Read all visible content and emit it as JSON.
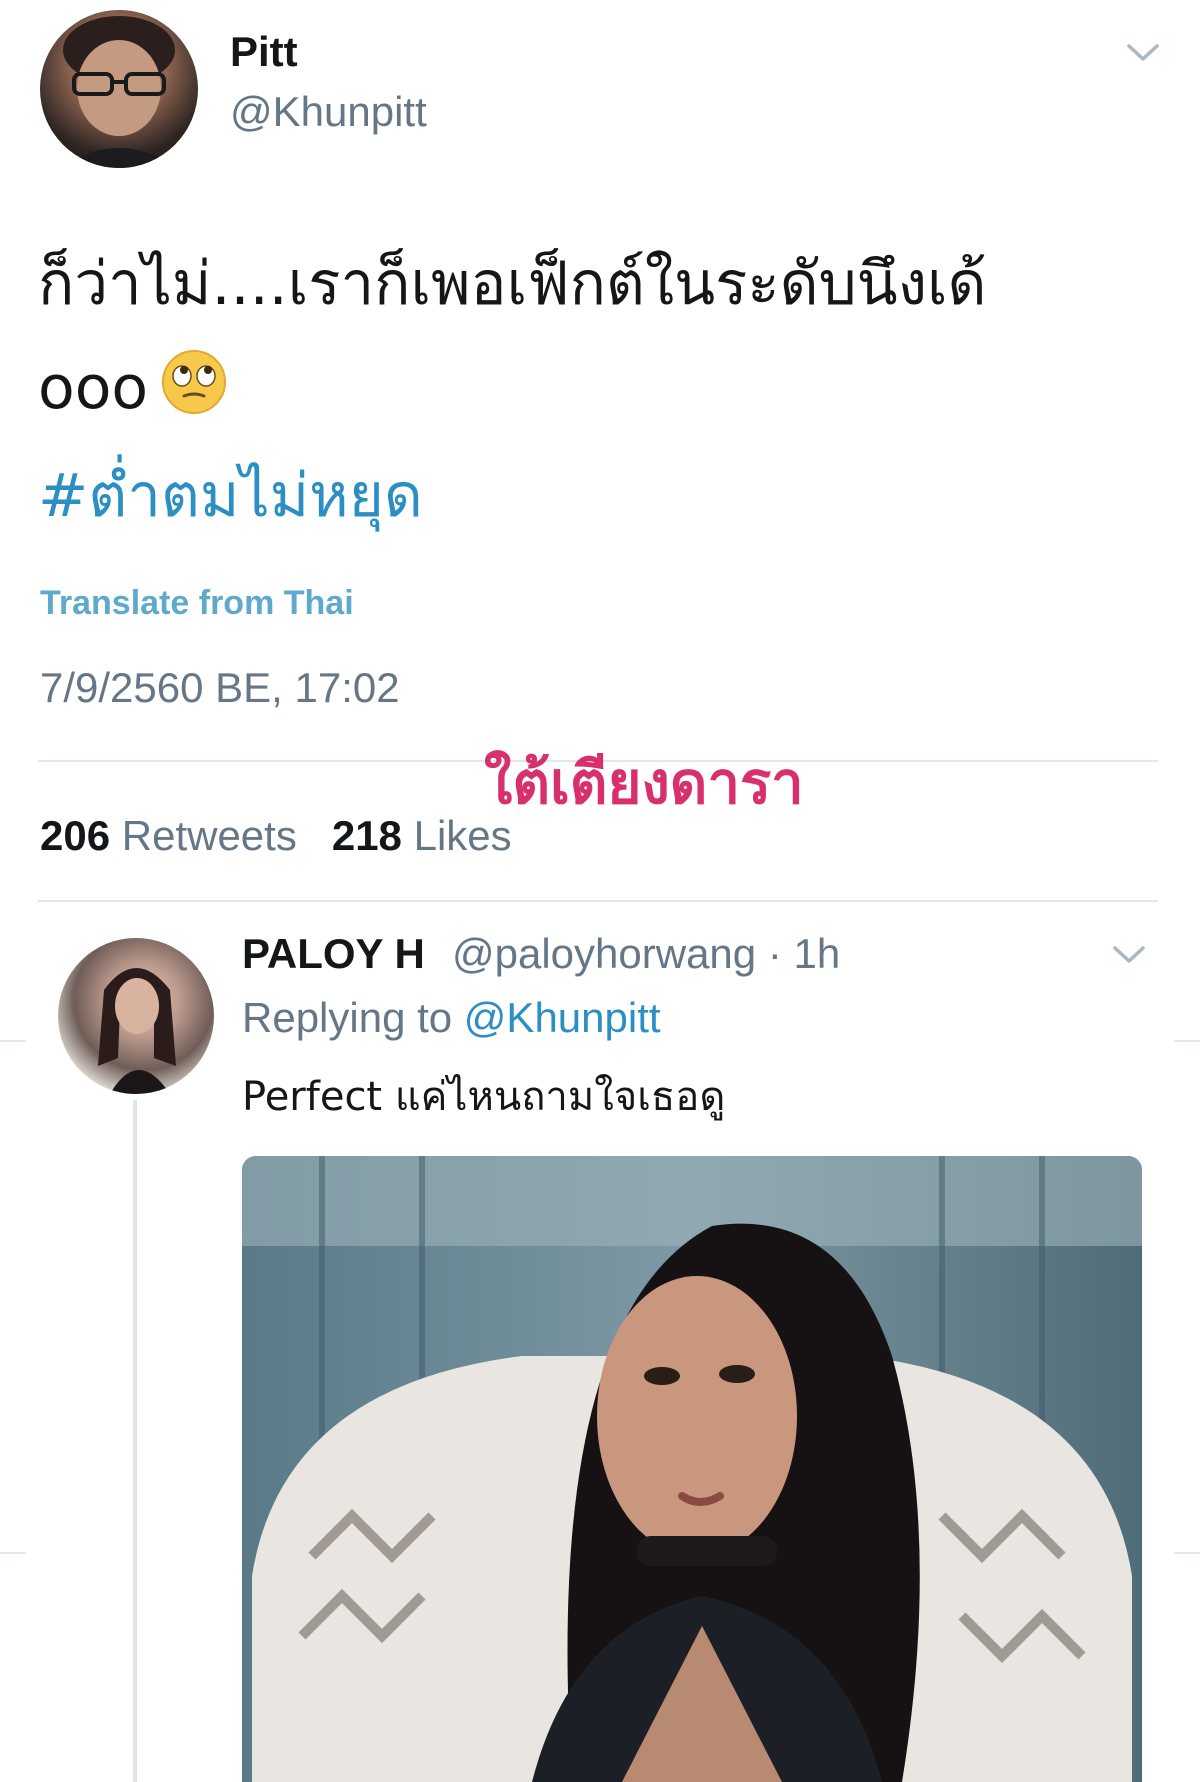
{
  "tweet": {
    "author_name": "Pitt",
    "author_handle": "@Khunpitt",
    "text_line1": "ก็ว่าไม่....เราก็เพอเฟ็กต์ในระดับนึงเด้",
    "text_line2": "ooo",
    "emoji": "face-with-rolling-eyes",
    "hashtag": "#ต่ำตมไม่หยุด",
    "translate_label": "Translate from Thai",
    "timestamp": "7/9/2560 BE, 17:02",
    "retweets_count": "206",
    "retweets_label": "Retweets",
    "likes_count": "218",
    "likes_label": "Likes"
  },
  "watermark": "ใต้เตียงดารา",
  "reply": {
    "author_name": "PALOY H",
    "author_handle_time": "@paloyhorwang · 1h",
    "replying_prefix": "Replying to",
    "replying_handle": "@Khunpitt",
    "text": "Perfect แค่ไหนถามใจเธอดู"
  },
  "colors": {
    "link": "#2b8fc4",
    "secondary_text": "#657786",
    "watermark": "#d8306b"
  }
}
